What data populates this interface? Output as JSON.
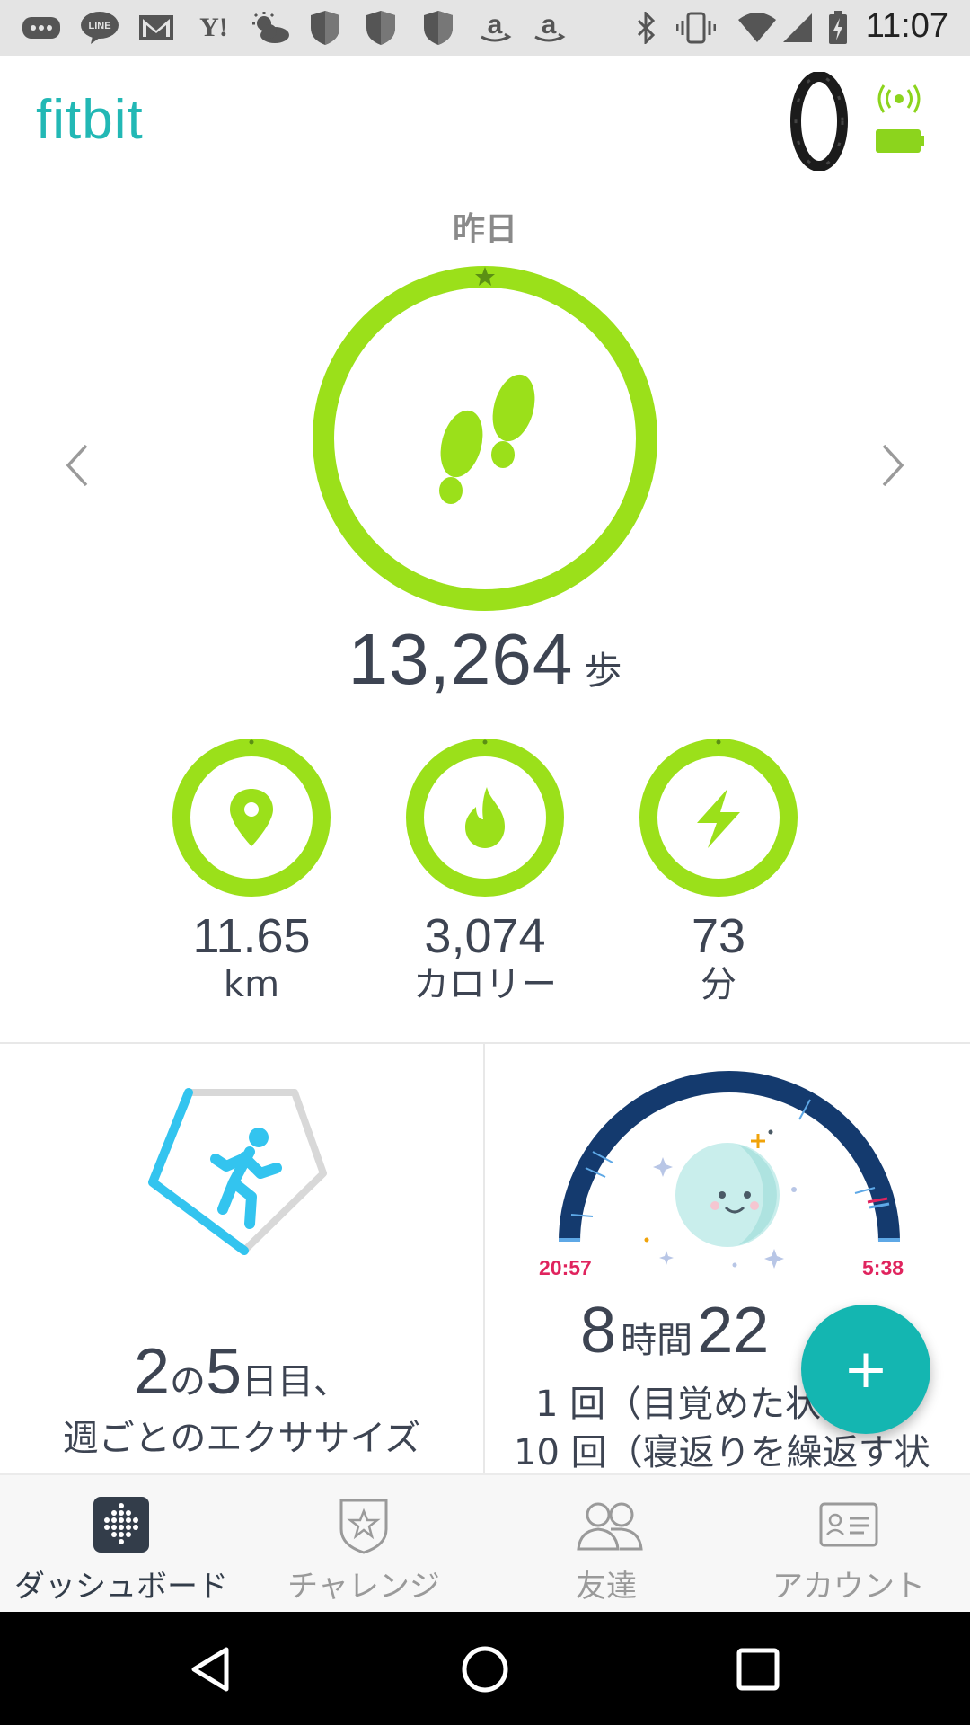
{
  "status_bar": {
    "time": "11:07",
    "left_icons": [
      "more-icon",
      "line-icon",
      "gmail-icon",
      "yahoo-icon",
      "weather-icon",
      "shield-icon",
      "shield-icon",
      "shield-icon",
      "amazon-icon",
      "amazon-icon"
    ],
    "line_label": "LINE",
    "yahoo_label": "Y!",
    "right_icons": [
      "bluetooth-icon",
      "vibrate-icon",
      "wifi-icon",
      "signal-icon",
      "battery-charging-icon"
    ]
  },
  "header": {
    "brand": "fitbit",
    "device": "tracker-band-icon",
    "sync_icon": "sync-signal-icon",
    "battery_icon": "device-battery-icon"
  },
  "day_label": "昨日",
  "steps": {
    "value": "13,264",
    "unit": "歩",
    "goal_progress": 1.0
  },
  "stats": [
    {
      "icon": "location-pin-icon",
      "value": "11.65",
      "unit": "km",
      "goal_progress": 1.0
    },
    {
      "icon": "flame-icon",
      "value": "3,074",
      "unit": "カロリー",
      "goal_progress": 1.0
    },
    {
      "icon": "lightning-icon",
      "value": "73",
      "unit": "分",
      "goal_progress": 1.0
    }
  ],
  "exercise": {
    "count": "2",
    "particle": "の",
    "total": "5",
    "suffix": "日目、",
    "subtitle": "週ごとのエクササイズ",
    "progress": 0.4
  },
  "sleep": {
    "start": "20:57",
    "end": "5:38",
    "hours": "8",
    "hours_unit": "時間",
    "minutes_partial": "22",
    "awake_line": "1 回（目覚めた状",
    "restless_line": "10 回（寝返りを繰返す状"
  },
  "fab": {
    "label": "+"
  },
  "bottom_nav": [
    {
      "label": "ダッシュボード",
      "icon": "dashboard-icon",
      "active": true
    },
    {
      "label": "チャレンジ",
      "icon": "challenge-badge-icon",
      "active": false
    },
    {
      "label": "友達",
      "icon": "friends-icon",
      "active": false
    },
    {
      "label": "アカウント",
      "icon": "account-card-icon",
      "active": false
    }
  ],
  "colors": {
    "accent": "#14b6b1",
    "brand": "#22b8b5",
    "goal_green": "#9be01a",
    "exercise_blue": "#33c4ef",
    "sleep_navy": "#143a6e",
    "sleep_time": "#e0245e"
  }
}
